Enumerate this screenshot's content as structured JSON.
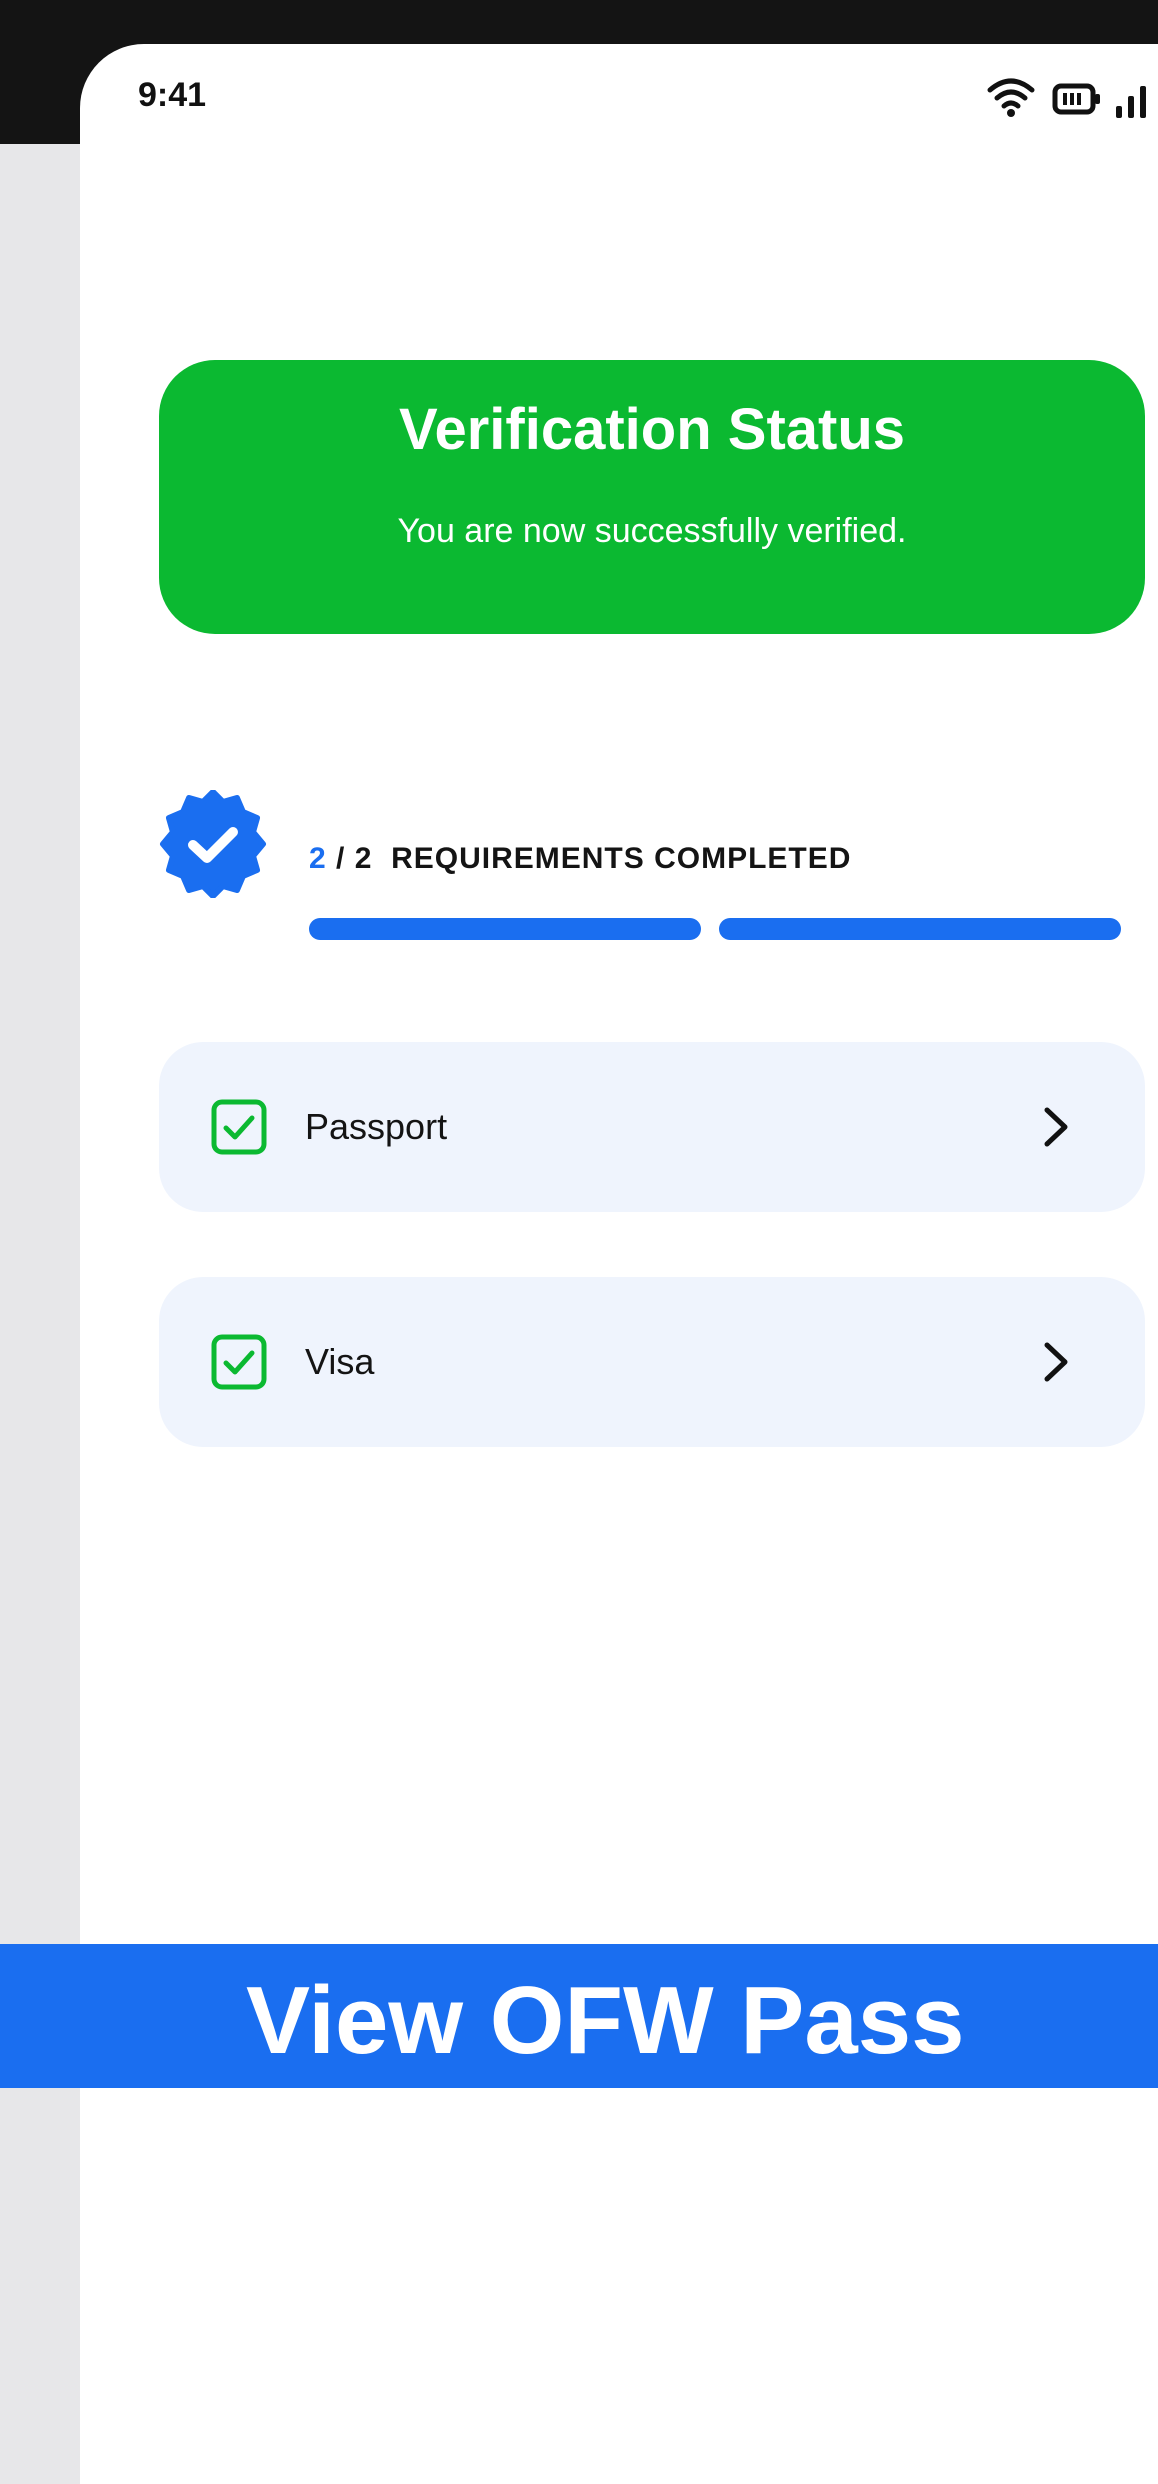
{
  "status_bar": {
    "time": "9:41",
    "icons": [
      "wifi-icon",
      "battery-icon",
      "signal-icon"
    ]
  },
  "verification_card": {
    "title": "Verification Status",
    "subtitle": "You are now successfully verified.",
    "color": "#0bb931"
  },
  "progress": {
    "completed": "2",
    "separator": "/",
    "total": "2",
    "label": "REQUIREMENTS COMPLETED",
    "segments_filled": 2,
    "segments_total": 2,
    "accent_color": "#1a6ef0"
  },
  "requirements": [
    {
      "label": "Passport",
      "checked": true
    },
    {
      "label": "Visa",
      "checked": true
    }
  ],
  "cta": {
    "label": "View OFW Pass",
    "color": "#1a6ef0"
  }
}
